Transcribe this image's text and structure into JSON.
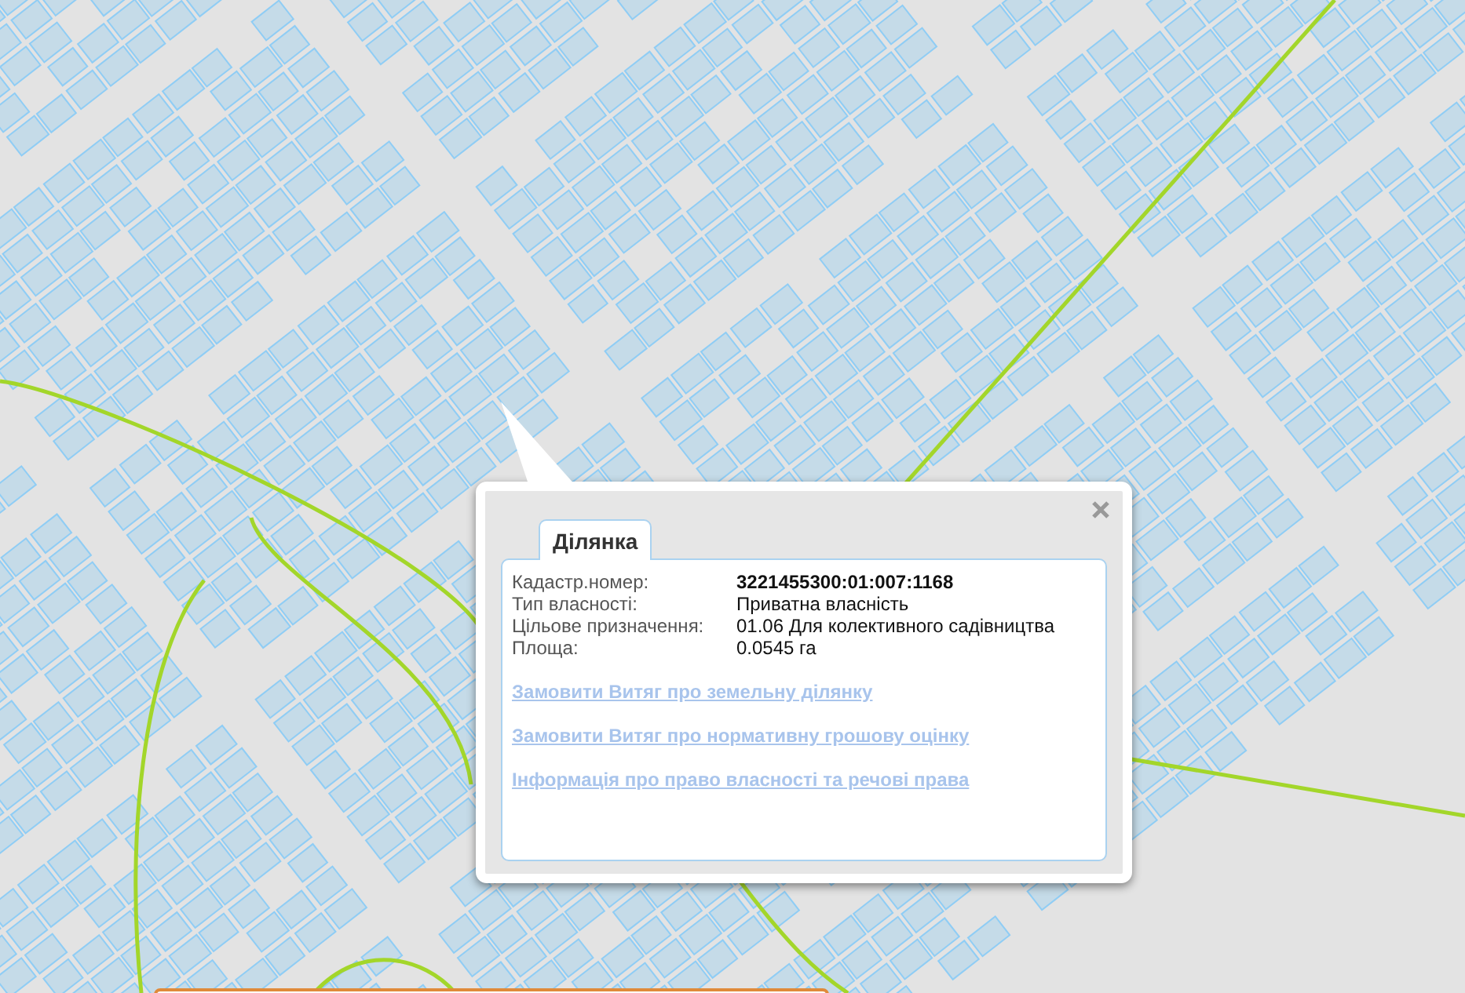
{
  "popup": {
    "tabs": [
      {
        "label": "Ділянка",
        "selected": true
      }
    ],
    "fields": [
      {
        "label": "Кадастр.номер:",
        "value": "3221455300:01:007:1168",
        "kind": "emphasized"
      },
      {
        "label": "Тип власності:",
        "value": "Приватна власність",
        "kind": "plain"
      },
      {
        "label": "Цільове призначення:",
        "value": "01.06 Для колективного садівництва",
        "kind": "plain"
      },
      {
        "label": "Площа:",
        "value": "0.0545 га",
        "kind": "plain"
      }
    ],
    "links": [
      "Замовити Витяг про земельну ділянку",
      "Замовити Витяг про нормативну грошову оцінку",
      "Інформація про право власності та речові права"
    ]
  }
}
